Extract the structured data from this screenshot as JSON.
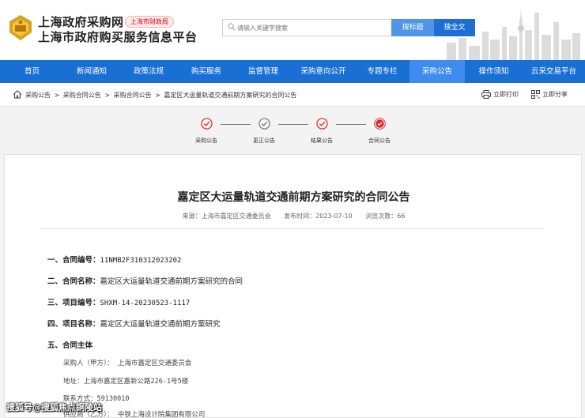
{
  "header": {
    "site_name": "上海政府采购网",
    "dept_badge": "上海市财政局",
    "platform_name": "上海市政府购买服务信息平台",
    "search_placeholder": "请输入关键字搜索",
    "search_title_btn": "搜标题",
    "search_full_btn": "搜全文"
  },
  "nav": {
    "items": [
      {
        "label": "首页",
        "active": false
      },
      {
        "label": "新闻通知",
        "active": false
      },
      {
        "label": "政策法规",
        "active": false
      },
      {
        "label": "购买服务",
        "active": false
      },
      {
        "label": "监督管理",
        "active": false
      },
      {
        "label": "采购意向公开",
        "active": false
      },
      {
        "label": "专题专栏",
        "active": false
      },
      {
        "label": "采购公告",
        "active": true
      },
      {
        "label": "操作须知",
        "active": false
      },
      {
        "label": "云采交易平台",
        "active": false
      }
    ]
  },
  "breadcrumb": {
    "items": [
      "采购公告",
      "采购合同公告",
      "采购合同公告",
      "嘉定区大运量轨道交通前期方案研究的合同公告"
    ],
    "separator": ">"
  },
  "actions": {
    "print": "立即打印",
    "share": "立即分享"
  },
  "steps": [
    {
      "label": "采购公告",
      "current": false
    },
    {
      "label": "更正公告",
      "current": false
    },
    {
      "label": "结果公告",
      "current": false
    },
    {
      "label": "合同公告",
      "current": true
    }
  ],
  "article": {
    "title": "嘉定区大运量轨道交通前期方案研究的合同公告",
    "source_label": "来源：",
    "source": "上海市嘉定区交通委员会",
    "date_label": "发布时间：",
    "date": "2023-07-10",
    "views_label": "浏览次数：",
    "views": "66",
    "sections": [
      {
        "label": "一、合同编号：",
        "value": "11NMB2F310312023202"
      },
      {
        "label": "二、合同名称：",
        "value": "嘉定区大运量轨道交通前期方案研究的合同"
      },
      {
        "label": "三、项目编号：",
        "value": "SHXM-14-20230523-1117"
      },
      {
        "label": "四、项目名称：",
        "value": "嘉定区大运量轨道交通前期方案研究"
      },
      {
        "label": "五、合同主体",
        "value": ""
      }
    ],
    "parties": [
      "采购人（甲方）： 上海市嘉定区交通委员会",
      "地址：上海市嘉定区嘉新公路226-1号5楼",
      "联系方式：59130010",
      "供应商（乙方）： 中铁上海设计院集团有限公司"
    ]
  },
  "watermark": "搜狐号@搜狐焦点铜陵站",
  "colors": {
    "nav_bg": "#1a6fd5",
    "nav_active": "#3e8cf0",
    "step_red": "#e02b2b",
    "badge_red": "#d7000f"
  }
}
